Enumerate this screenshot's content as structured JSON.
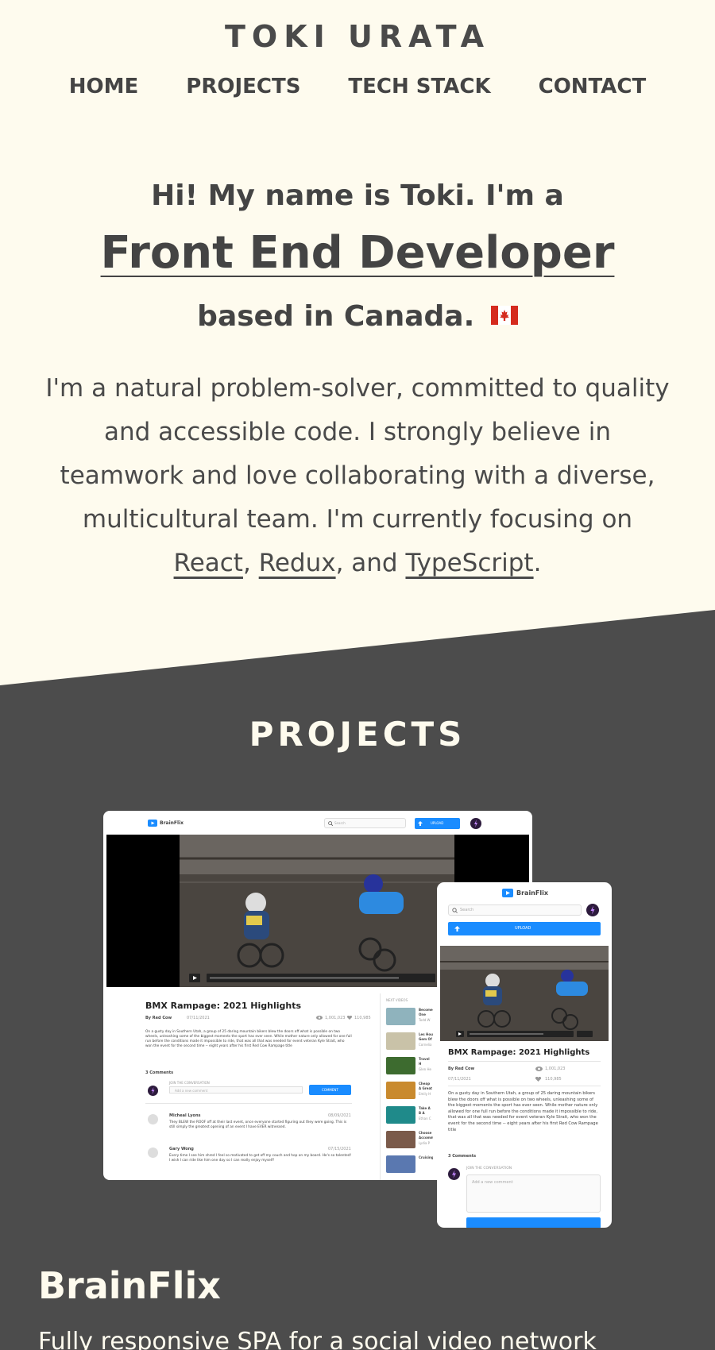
{
  "header": {
    "title": "TOKI URATA",
    "nav": [
      "HOME",
      "PROJECTS",
      "TECH STACK",
      "CONTACT"
    ]
  },
  "hero": {
    "greeting": "Hi! My name is Toki. I'm a",
    "role": "Front End Developer",
    "location": "based in Canada.",
    "intro_text": "I'm a natural problem-solver, committed to quality and accessible code. I strongly believe in teamwork and love collaborating with a diverse, multicultural team. I'm currently focusing on",
    "tech": [
      "React",
      "Redux",
      "TypeScript"
    ],
    "sep1": ",",
    "sep2": ", and",
    "end": "."
  },
  "projects": {
    "heading": "PROJECTS",
    "items": [
      {
        "name": "BrainFlix",
        "description": "Fully responsive SPA for a social video network",
        "screenshot": {
          "brand": "BrainFlix",
          "search_placeholder": "Search",
          "upload_label": "UPLOAD",
          "video_title": "BMX Rampage: 2021 Highlights",
          "channel": "By Red Cow",
          "date": "07/11/2021",
          "views": "1,001,023",
          "likes": "110,985",
          "description": "On a gusty day in Southern Utah, a group of 25 daring mountain bikers blew the doors off what is possible on two wheels, unleashing some of the biggest moments the sport has ever seen. While mother nature only allowed for one full run before the conditions made it impossible to ride, that was all that was needed for event veteran Kyle Strait, who won the event for the second time -- eight years after his first Red Cow Rampage title",
          "comments_count": "3 Comments",
          "join_label": "JOIN THE CONVERSATION",
          "comment_placeholder": "Add a new comment",
          "comment_button": "COMMENT",
          "next_videos_label": "NEXT VIDEOS",
          "comments": [
            {
              "name": "Micheal Lyons",
              "date": "08/09/2021",
              "text": "They BLEW the ROOF off at their last event, once everyone started figuring out they were going. This is still simply the greatest opening of an event I have EVER witnessed."
            },
            {
              "name": "Gary Wong",
              "date": "07/15/2021",
              "text": "Every time I see him shred I feel so motivated to get off my couch and hop on my board. He's so talented! I wish I can ride like him one day so I can really enjoy myself!"
            }
          ],
          "next_videos": [
            {
              "title": "Become One Eas",
              "author": "Todd W"
            },
            {
              "title": "Les Hou Gem Of",
              "author": "Cornelia"
            },
            {
              "title": "Travel H Medical",
              "author": "Glen He"
            },
            {
              "title": "Cheap A Great W",
              "author": "Emily H"
            },
            {
              "title": "Take A B A Bouti",
              "author": "Ethan C"
            },
            {
              "title": "Choose Accomm",
              "author": "Lydia P"
            },
            {
              "title": "Cruising",
              "author": ""
            }
          ]
        }
      }
    ]
  },
  "colors": {
    "background": "#fefbee",
    "text": "#444444",
    "dark_section": "#4c4c4c",
    "light_text": "#fefbee",
    "accent_blue": "#1a8cff",
    "flag_red": "#d52b1e"
  },
  "icons": {
    "flag": "canada-flag-icon",
    "brand_logo": "play-logo-icon",
    "search": "search-icon",
    "upload": "upload-icon",
    "views": "eye-icon",
    "likes": "heart-icon",
    "avatar": "avatar-icon"
  }
}
